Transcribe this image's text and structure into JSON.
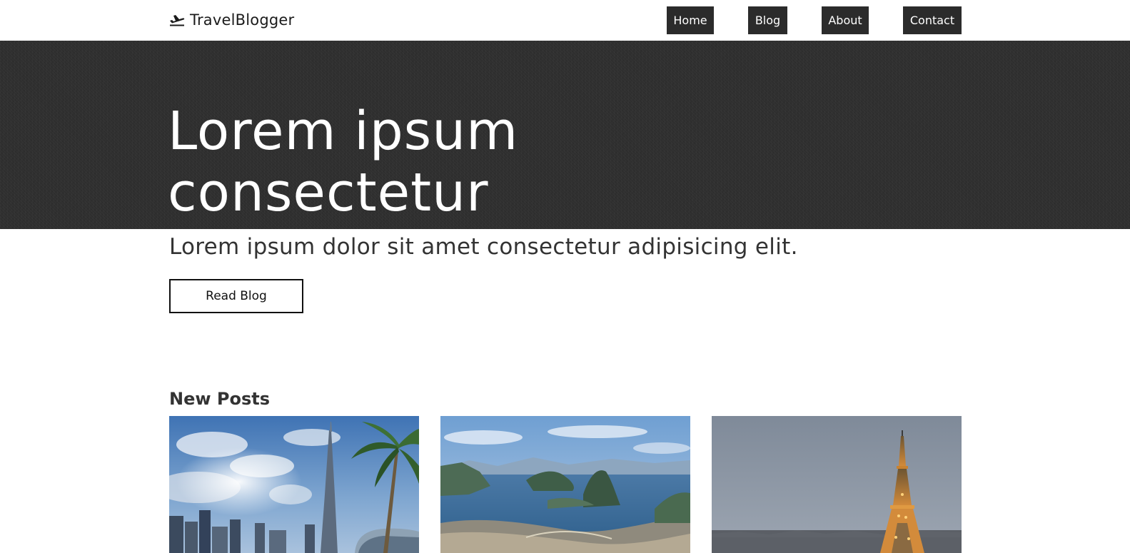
{
  "brand": {
    "name": "TravelBlogger",
    "icon": "airplane-departure-icon"
  },
  "nav": [
    {
      "label": "Home"
    },
    {
      "label": "Blog"
    },
    {
      "label": "About"
    },
    {
      "label": "Contact"
    }
  ],
  "hero": {
    "title_line1": "Lorem ipsum",
    "title_line2": "consectetur",
    "subtitle": "Lorem ipsum dolor sit amet consectetur adipisicing elit.",
    "cta_label": "Read Blog"
  },
  "posts": {
    "heading": "New Posts",
    "items": [
      {
        "image": "dubai-skyline-photo"
      },
      {
        "image": "rio-de-janeiro-bay-photo"
      },
      {
        "image": "paris-eiffel-tower-photo"
      }
    ]
  },
  "colors": {
    "nav_bg": "#2b2b2b",
    "hero_bg": "#2f2f2f",
    "text": "#333333"
  }
}
